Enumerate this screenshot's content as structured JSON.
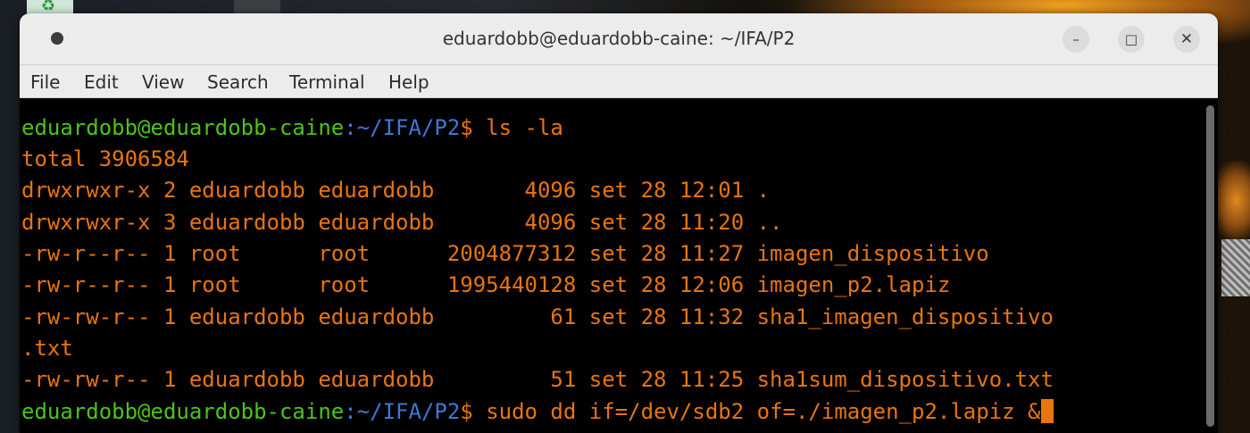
{
  "window": {
    "title": "eduardobb@eduardobb-caine: ~/IFA/P2",
    "minimize_glyph": "–",
    "maximize_glyph": "□",
    "close_glyph": "✕"
  },
  "menu": [
    "File",
    "Edit",
    "View",
    "Search",
    "Terminal",
    "Help"
  ],
  "terminal": {
    "prompt_user": "eduardobb@eduardobb-caine",
    "prompt_path": ":~/IFA/P2",
    "prompt_symbol": "$ ",
    "command1": "ls -la",
    "total": "total 3906584",
    "rows": [
      "drwxrwxr-x 2 eduardobb eduardobb       4096 set 28 12:01 .",
      "drwxrwxr-x 3 eduardobb eduardobb       4096 set 28 11:20 ..",
      "-rw-r--r-- 1 root      root      2004877312 set 28 11:27 imagen_dispositivo",
      "-rw-r--r-- 1 root      root      1995440128 set 28 12:06 imagen_p2.lapiz",
      "-rw-rw-r-- 1 eduardobb eduardobb         61 set 28 11:32 sha1_imagen_dispositivo",
      ".txt",
      "-rw-rw-r-- 1 eduardobb eduardobb         51 set 28 11:25 sha1sum_dispositivo.txt"
    ],
    "command2": "sudo dd if=/dev/sdb2 of=./imagen_p2.lapiz &"
  },
  "colors": {
    "prompt_user": "#4cc41b",
    "prompt_path": "#3c78d8",
    "output": "#e8750f",
    "terminal_bg": "#000000"
  }
}
